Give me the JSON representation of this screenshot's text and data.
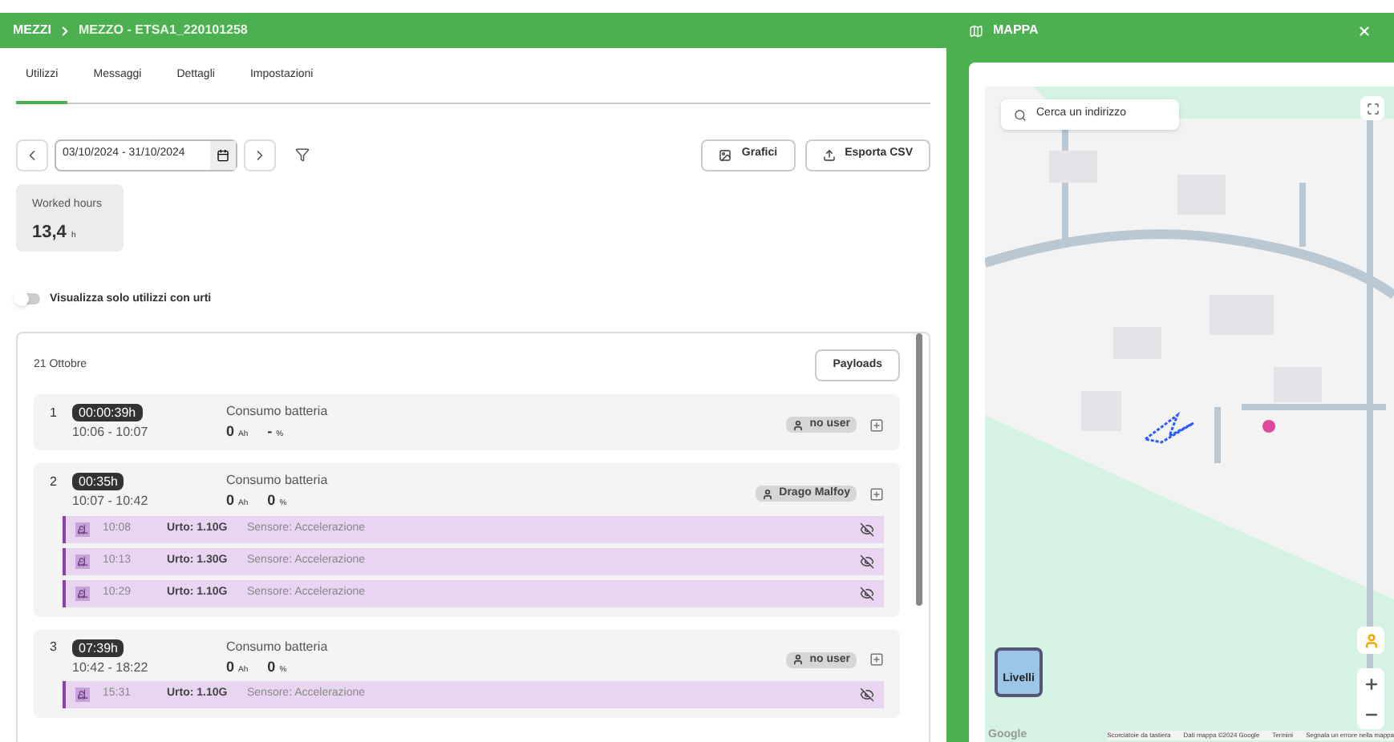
{
  "header": {
    "breadcrumb": [
      "MEZZI",
      "MEZZO - ETSA1_220101258"
    ]
  },
  "tabs": [
    {
      "label": "Utilizzi",
      "selected": true
    },
    {
      "label": "Messaggi",
      "selected": false
    },
    {
      "label": "Dettagli",
      "selected": false
    },
    {
      "label": "Impostazioni",
      "selected": false
    }
  ],
  "toolbar": {
    "date_range": "03/10/2024 - 31/10/2024",
    "buttons": [
      {
        "kind": "chart",
        "label": "Grafici"
      },
      {
        "kind": "export",
        "label": "Esporta CSV"
      }
    ]
  },
  "stat": {
    "label": "Worked hours",
    "value": "13,4",
    "unit": "h"
  },
  "toggle": {
    "label": "Visualizza solo utilizzi con urti",
    "on": false
  },
  "day": {
    "title": "21 Ottobre",
    "button": "Payloads"
  },
  "sessions": [
    {
      "index": "1",
      "duration": "00:00:39h",
      "time": "10:06 - 10:07",
      "metric_label": "Consumo batteria",
      "ah": "0",
      "ah_unit": "Ah",
      "pct": "-",
      "pct_unit": "%",
      "user": "no user"
    },
    {
      "index": "2",
      "duration": "00:35h",
      "time": "10:07 - 10:42",
      "metric_label": "Consumo batteria",
      "ah": "0",
      "ah_unit": "Ah",
      "pct": "0",
      "pct_unit": "%",
      "user": "Drago Malfoy",
      "impacts": [
        {
          "time": "10:08",
          "value": "Urto: 1.10G",
          "sensor": "Sensore: Accelerazione"
        },
        {
          "time": "10:13",
          "value": "Urto: 1.30G",
          "sensor": "Sensore: Accelerazione"
        },
        {
          "time": "10:29",
          "value": "Urto: 1.10G",
          "sensor": "Sensore: Accelerazione"
        }
      ]
    },
    {
      "index": "3",
      "duration": "07:39h",
      "time": "10:42 - 18:22",
      "metric_label": "Consumo batteria",
      "ah": "0",
      "ah_unit": "Ah",
      "pct": "0",
      "pct_unit": "%",
      "user": "no user",
      "impacts": [
        {
          "time": "15:31",
          "value": "Urto: 1.10G",
          "sensor": "Sensore: Accelerazione"
        }
      ]
    }
  ],
  "map": {
    "title": "MAPPA",
    "search_placeholder": "Cerca un indirizzo",
    "layers_label": "Livelli",
    "logo": "Google",
    "attribution": [
      "Scorciatoie da tastiera",
      "Dati mappa ©2024 Google",
      "Termini",
      "Segnala un errore nella mappa"
    ]
  }
}
